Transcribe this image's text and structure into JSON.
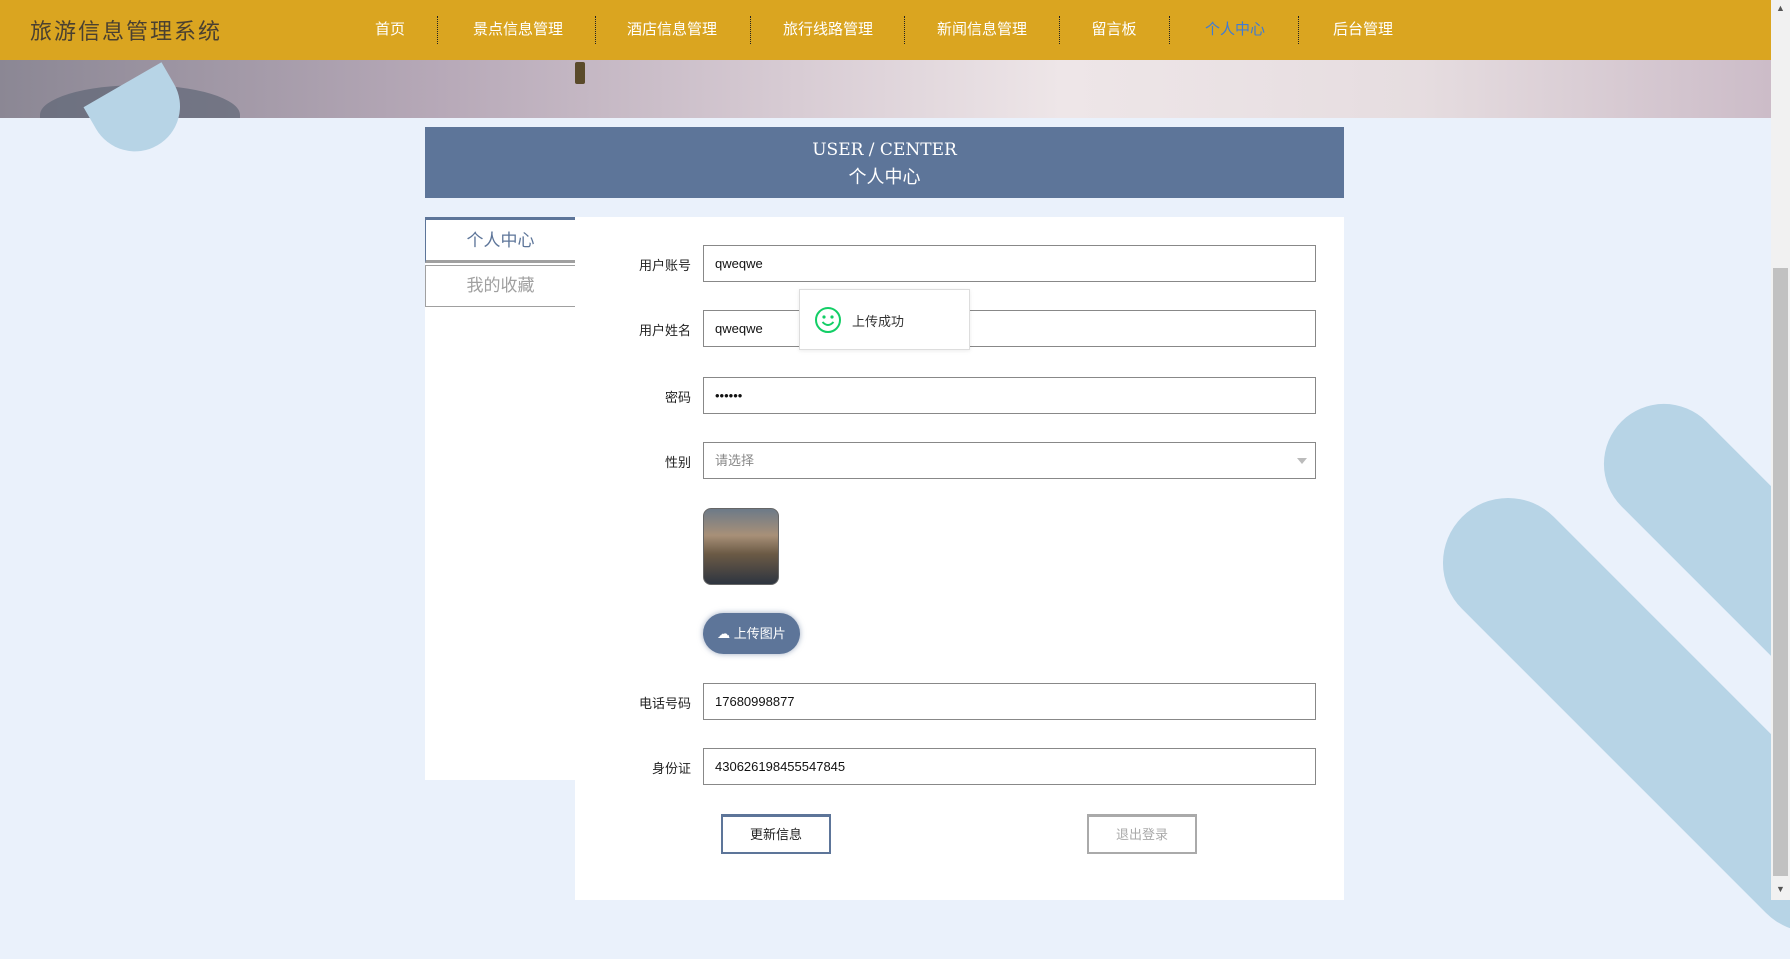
{
  "header": {
    "logo": "旅游信息管理系统",
    "nav": [
      "首页",
      "景点信息管理",
      "酒店信息管理",
      "旅行线路管理",
      "新闻信息管理",
      "留言板",
      "个人中心",
      "后台管理"
    ],
    "active": "个人中心"
  },
  "title": {
    "en": "USER / CENTER",
    "cn": "个人中心"
  },
  "sidebar": {
    "items": [
      "个人中心",
      "我的收藏"
    ]
  },
  "form": {
    "account_label": "用户账号",
    "account": "qweqwe",
    "name_label": "用户姓名",
    "name": "qweqwe",
    "password_label": "密码",
    "password": "••••••",
    "gender_label": "性别",
    "gender_placeholder": "请选择",
    "upload_label": "上传图片",
    "phone_label": "电话号码",
    "phone": "17680998877",
    "id_label": "身份证",
    "id": "430626198455547845",
    "update_label": "更新信息",
    "logout_label": "退出登录"
  },
  "toast": {
    "message": "上传成功",
    "icon": "smile-icon",
    "color": "#13ce66"
  },
  "colors": {
    "header": "#daa520",
    "accent": "#5d7599",
    "active_nav": "#3e7bd6"
  }
}
